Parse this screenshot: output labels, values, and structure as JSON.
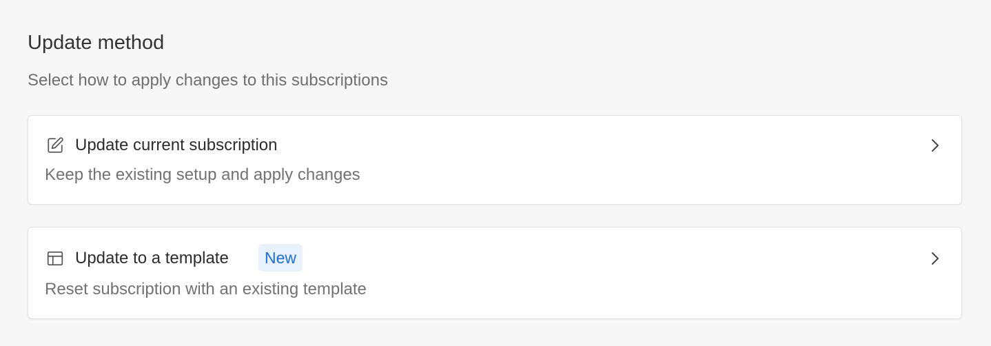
{
  "section": {
    "title": "Update method",
    "subtitle": "Select how to apply changes to this subscriptions"
  },
  "options": [
    {
      "icon": "edit-icon",
      "title": "Update current subscription",
      "description": "Keep the existing setup and apply changes",
      "badge": ""
    },
    {
      "icon": "layout-template-icon",
      "title": "Update to a template",
      "description": "Reset subscription with an existing template",
      "badge": "New"
    }
  ],
  "colors": {
    "background": "#f7f7f7",
    "card_background": "#ffffff",
    "badge_background": "#e8f1fc",
    "badge_text": "#1a6fd8"
  }
}
